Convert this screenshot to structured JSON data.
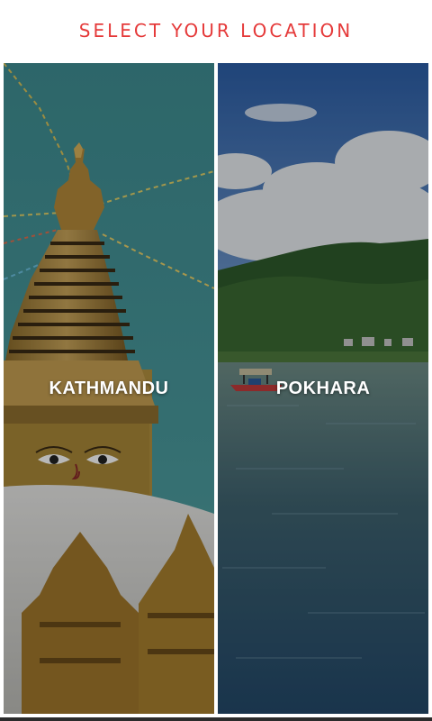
{
  "header": {
    "title": "SELECT YOUR LOCATION"
  },
  "locations": [
    {
      "name": "KATHMANDU",
      "image": "swayambhunath-stupa-photo"
    },
    {
      "name": "POKHARA",
      "image": "phewa-lake-boat-photo"
    }
  ],
  "colors": {
    "title": "#e53a3a",
    "label": "#ffffff"
  }
}
